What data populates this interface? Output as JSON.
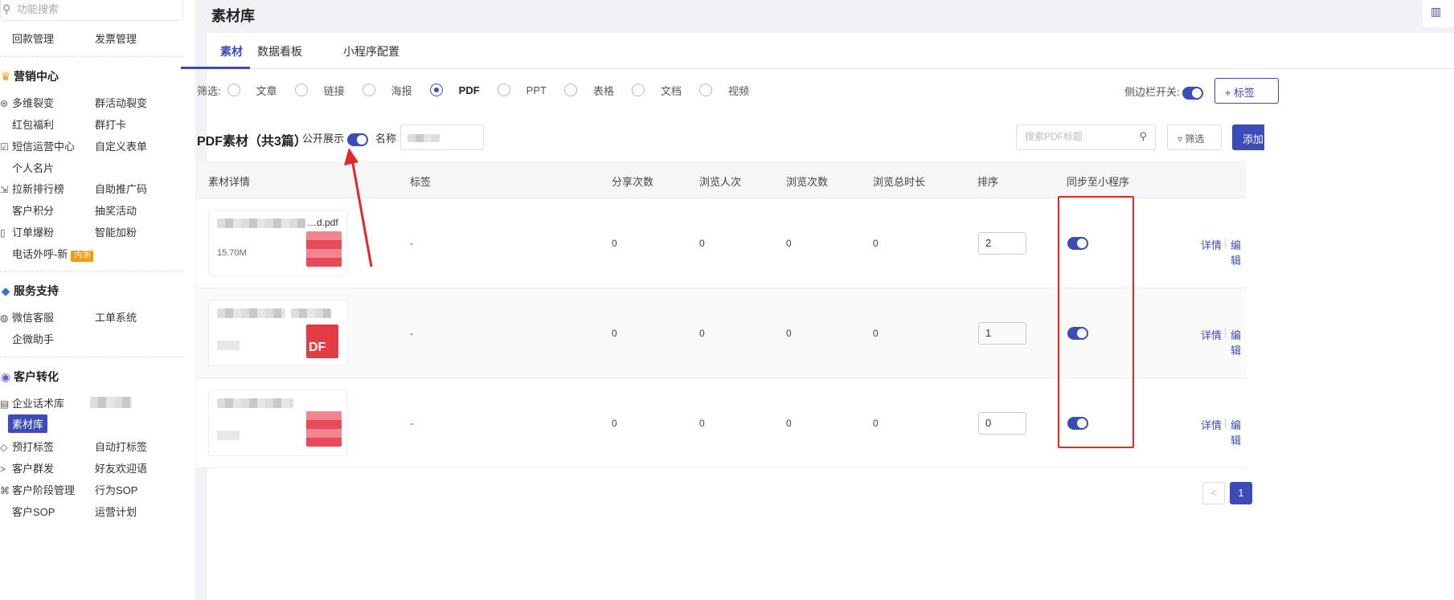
{
  "sidebar": {
    "search_placeholder": "功能搜索",
    "top_items": [
      "回款管理",
      "发票管理"
    ],
    "sections": [
      {
        "title": "营销中心",
        "icon": "trophy-icon",
        "items": [
          "多维裂变",
          "群活动裂变",
          "红包福利",
          "群打卡",
          "短信运营中心",
          "自定义表单",
          "个人名片",
          "拉新排行榜",
          "自助推广码",
          "客户积分",
          "抽奖活动",
          "订单爆粉",
          "智能加粉",
          "电话外呼-新"
        ],
        "badge": "内测"
      },
      {
        "title": "服务支持",
        "icon": "service-icon",
        "items": [
          "微信客服",
          "工单系统",
          "企微助手"
        ]
      },
      {
        "title": "客户转化",
        "icon": "convert-icon",
        "items": [
          "企业话术库",
          "素材库",
          "预打标签",
          "自动打标签",
          "客户群发",
          "好友欢迎语",
          "客户阶段管理",
          "行为SOP",
          "客户SOP",
          "运营计划"
        ]
      }
    ]
  },
  "header": {
    "title": "素材库"
  },
  "tabs": [
    "素材",
    "数据看板",
    "小程序配置"
  ],
  "filter": {
    "label": "筛选:",
    "options": [
      "文章",
      "链接",
      "海报",
      "PDF",
      "PPT",
      "表格",
      "文档",
      "视频"
    ],
    "selected": "PDF"
  },
  "sidebar_toggle_label": "侧边栏开关:",
  "tag_button": "标签",
  "toolbar": {
    "title": "PDF素材（共3篇）",
    "public_label": "公开展示",
    "name_label": "名称",
    "search_placeholder": "搜索PDF标题",
    "filter_button": "筛选",
    "add_button": "添加"
  },
  "table": {
    "columns": [
      "素材详情",
      "标签",
      "分享次数",
      "浏览人次",
      "浏览次数",
      "浏览总时长",
      "排序",
      "同步至小程序"
    ],
    "rows": [
      {
        "file_suffix": "…d.pdf",
        "size": "15.70M",
        "tag": "-",
        "shares": "0",
        "visitors": "0",
        "views": "0",
        "duration": "0",
        "sort": "2",
        "sync": true,
        "thumb_text": ""
      },
      {
        "file_suffix": "",
        "size": "",
        "tag": "-",
        "shares": "0",
        "visitors": "0",
        "views": "0",
        "duration": "0",
        "sort": "1",
        "sync": true,
        "thumb_text": "DF"
      },
      {
        "file_suffix": "",
        "size": "",
        "tag": "-",
        "shares": "0",
        "visitors": "0",
        "views": "0",
        "duration": "0",
        "sort": "0",
        "sync": true,
        "thumb_text": ""
      }
    ],
    "actions": {
      "detail": "详情",
      "edit": "编辑"
    }
  },
  "pagination": {
    "prev": "<",
    "current": "1"
  },
  "colors": {
    "accent": "#3b4cb8",
    "highlight_box": "#e5262b",
    "annotation_arrow": "#e5262b"
  }
}
